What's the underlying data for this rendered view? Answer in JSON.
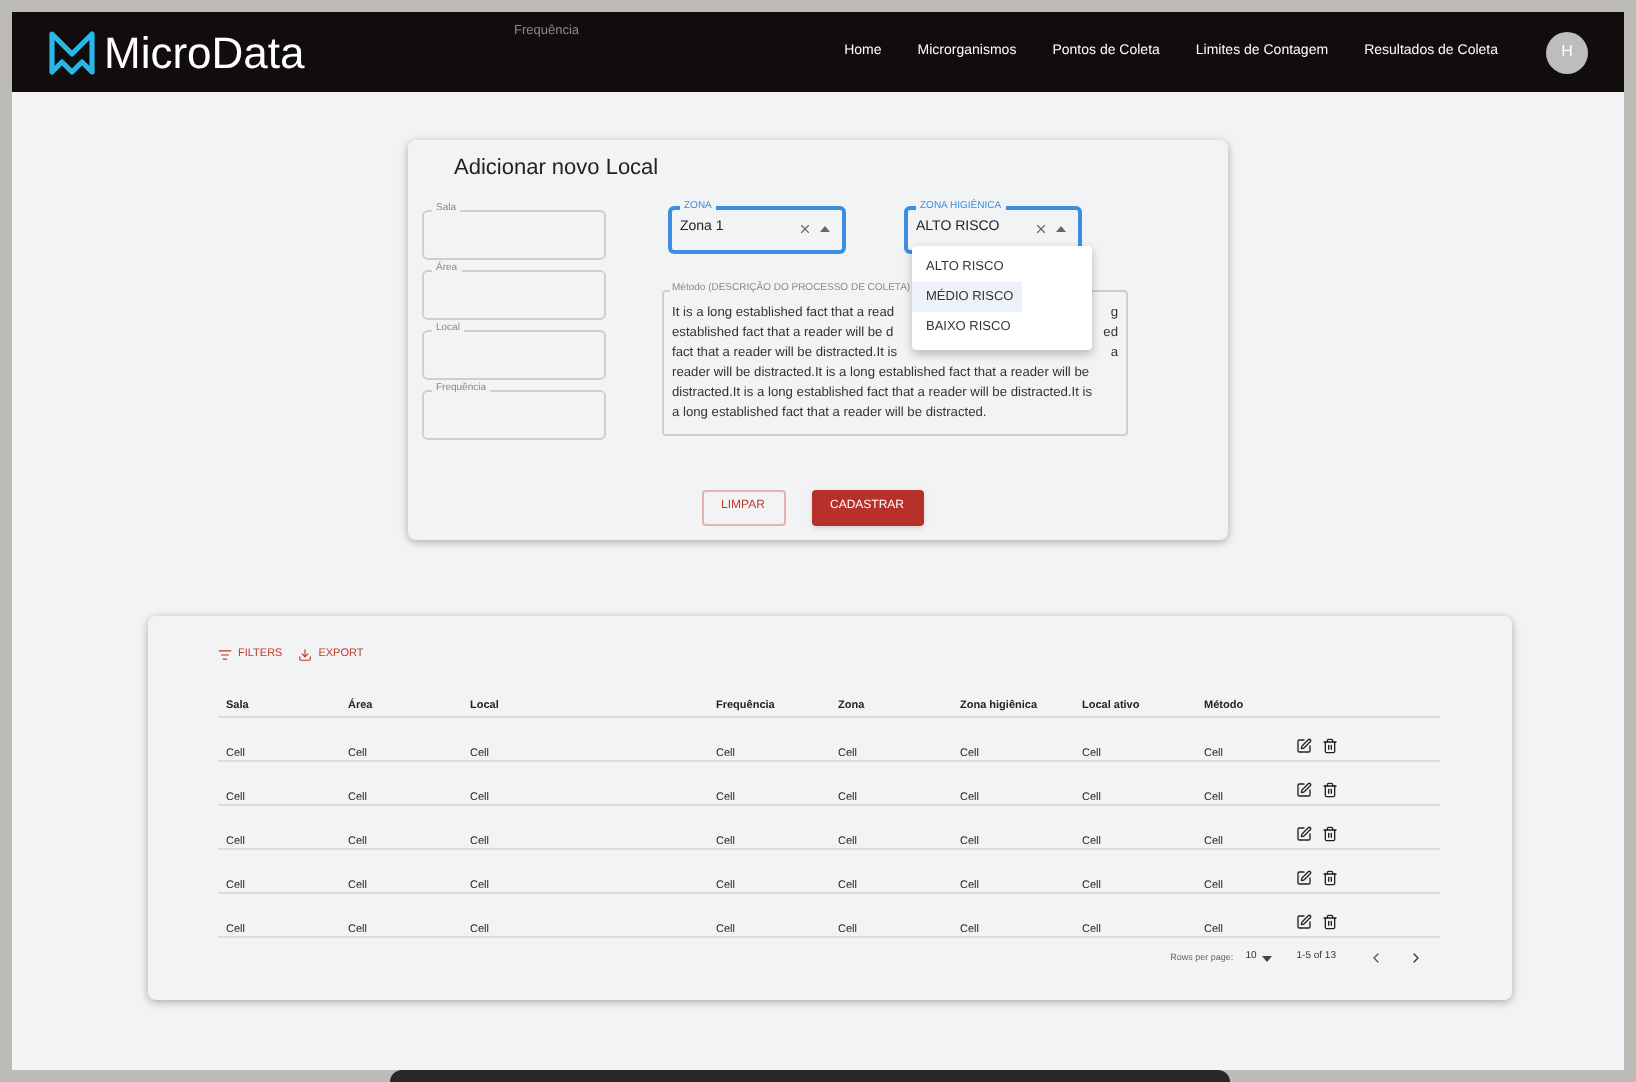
{
  "header": {
    "logo": "MicroData",
    "stray_label": "Frequência",
    "nav": [
      "Home",
      "Microrganismos",
      "Pontos de Coleta",
      "Limites de Contagem",
      "Resultados de Coleta"
    ],
    "avatar": "H"
  },
  "form": {
    "title": "Adicionar novo Local",
    "fields": [
      {
        "label": "Sala"
      },
      {
        "label": "Área"
      },
      {
        "label": "Local"
      },
      {
        "label": "Frequência"
      }
    ],
    "selects": [
      {
        "label": "ZONA",
        "value": "Zona 1",
        "focused": true
      },
      {
        "label": "ZONA HIGIÊNICA",
        "value": "ALTO RISCO",
        "focused": true
      }
    ],
    "menu": [
      {
        "label": "ALTO RISCO",
        "selected": false
      },
      {
        "label": "MÉDIO RISCO",
        "selected": true
      },
      {
        "label": "BAIXO RISCO",
        "selected": false
      }
    ],
    "method": {
      "label": "Método (DESCRIÇÃO DO PROCESSO DE COLETA)",
      "lines": [
        {
          "left": "It is a long established fact that a read",
          "right": "g"
        },
        {
          "left": "established fact that a reader will be d",
          "right": "ed"
        },
        {
          "left": "fact that a reader will be distracted.It is",
          "right": "a"
        },
        {
          "left": "reader will be distracted.It is a long established fact that a reader will be"
        },
        {
          "left": "distracted.It is a long established fact that a reader will be distracted.It is"
        },
        {
          "left": "a long established fact that a reader will be distracted."
        }
      ]
    },
    "buttons": [
      {
        "label": "LIMPAR",
        "kind": "outlined"
      },
      {
        "label": "CADASTRAR",
        "kind": "contained"
      }
    ]
  },
  "table": {
    "toolbar": [
      "FILTERS",
      "EXPORT"
    ],
    "columns": [
      "Sala",
      "Área",
      "Local",
      "Frequência",
      "Zona",
      "Zona higiênica",
      "Local ativo",
      "Método"
    ],
    "rows": [
      [
        "Cell",
        "Cell",
        "Cell",
        "Cell",
        "Cell",
        "Cell",
        "Cell",
        "Cell"
      ],
      [
        "Cell",
        "Cell",
        "Cell",
        "Cell",
        "Cell",
        "Cell",
        "Cell",
        "Cell"
      ],
      [
        "Cell",
        "Cell",
        "Cell",
        "Cell",
        "Cell",
        "Cell",
        "Cell",
        "Cell"
      ],
      [
        "Cell",
        "Cell",
        "Cell",
        "Cell",
        "Cell",
        "Cell",
        "Cell",
        "Cell"
      ],
      [
        "Cell",
        "Cell",
        "Cell",
        "Cell",
        "Cell",
        "Cell",
        "Cell",
        "Cell"
      ]
    ],
    "pagination": {
      "rows_label": "Rows per page:",
      "rows_value": "10",
      "range": "1-5 of 13"
    }
  }
}
